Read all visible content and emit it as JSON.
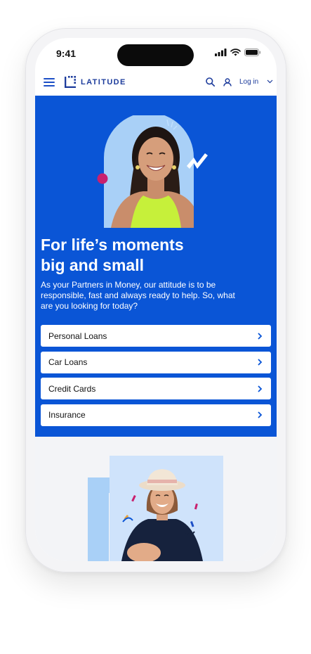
{
  "status_bar": {
    "time": "9:41"
  },
  "nav": {
    "brand": "LATITUDE",
    "login_label": "Log in"
  },
  "hero": {
    "title_line1": "For life’s moments",
    "title_line2": "big and small",
    "subtitle": "As your Partners in Money, our attitude is to be responsible, fast and always ready to help. So, what are you looking for today?",
    "products": [
      {
        "label": "Personal Loans"
      },
      {
        "label": "Car Loans"
      },
      {
        "label": "Credit Cards"
      },
      {
        "label": "Insurance"
      }
    ]
  },
  "colors": {
    "brand_blue": "#0a55d6",
    "logo_navy": "#1d3c9c",
    "accent_pink": "#c9206e",
    "light_blue": "#a9d0f7"
  }
}
